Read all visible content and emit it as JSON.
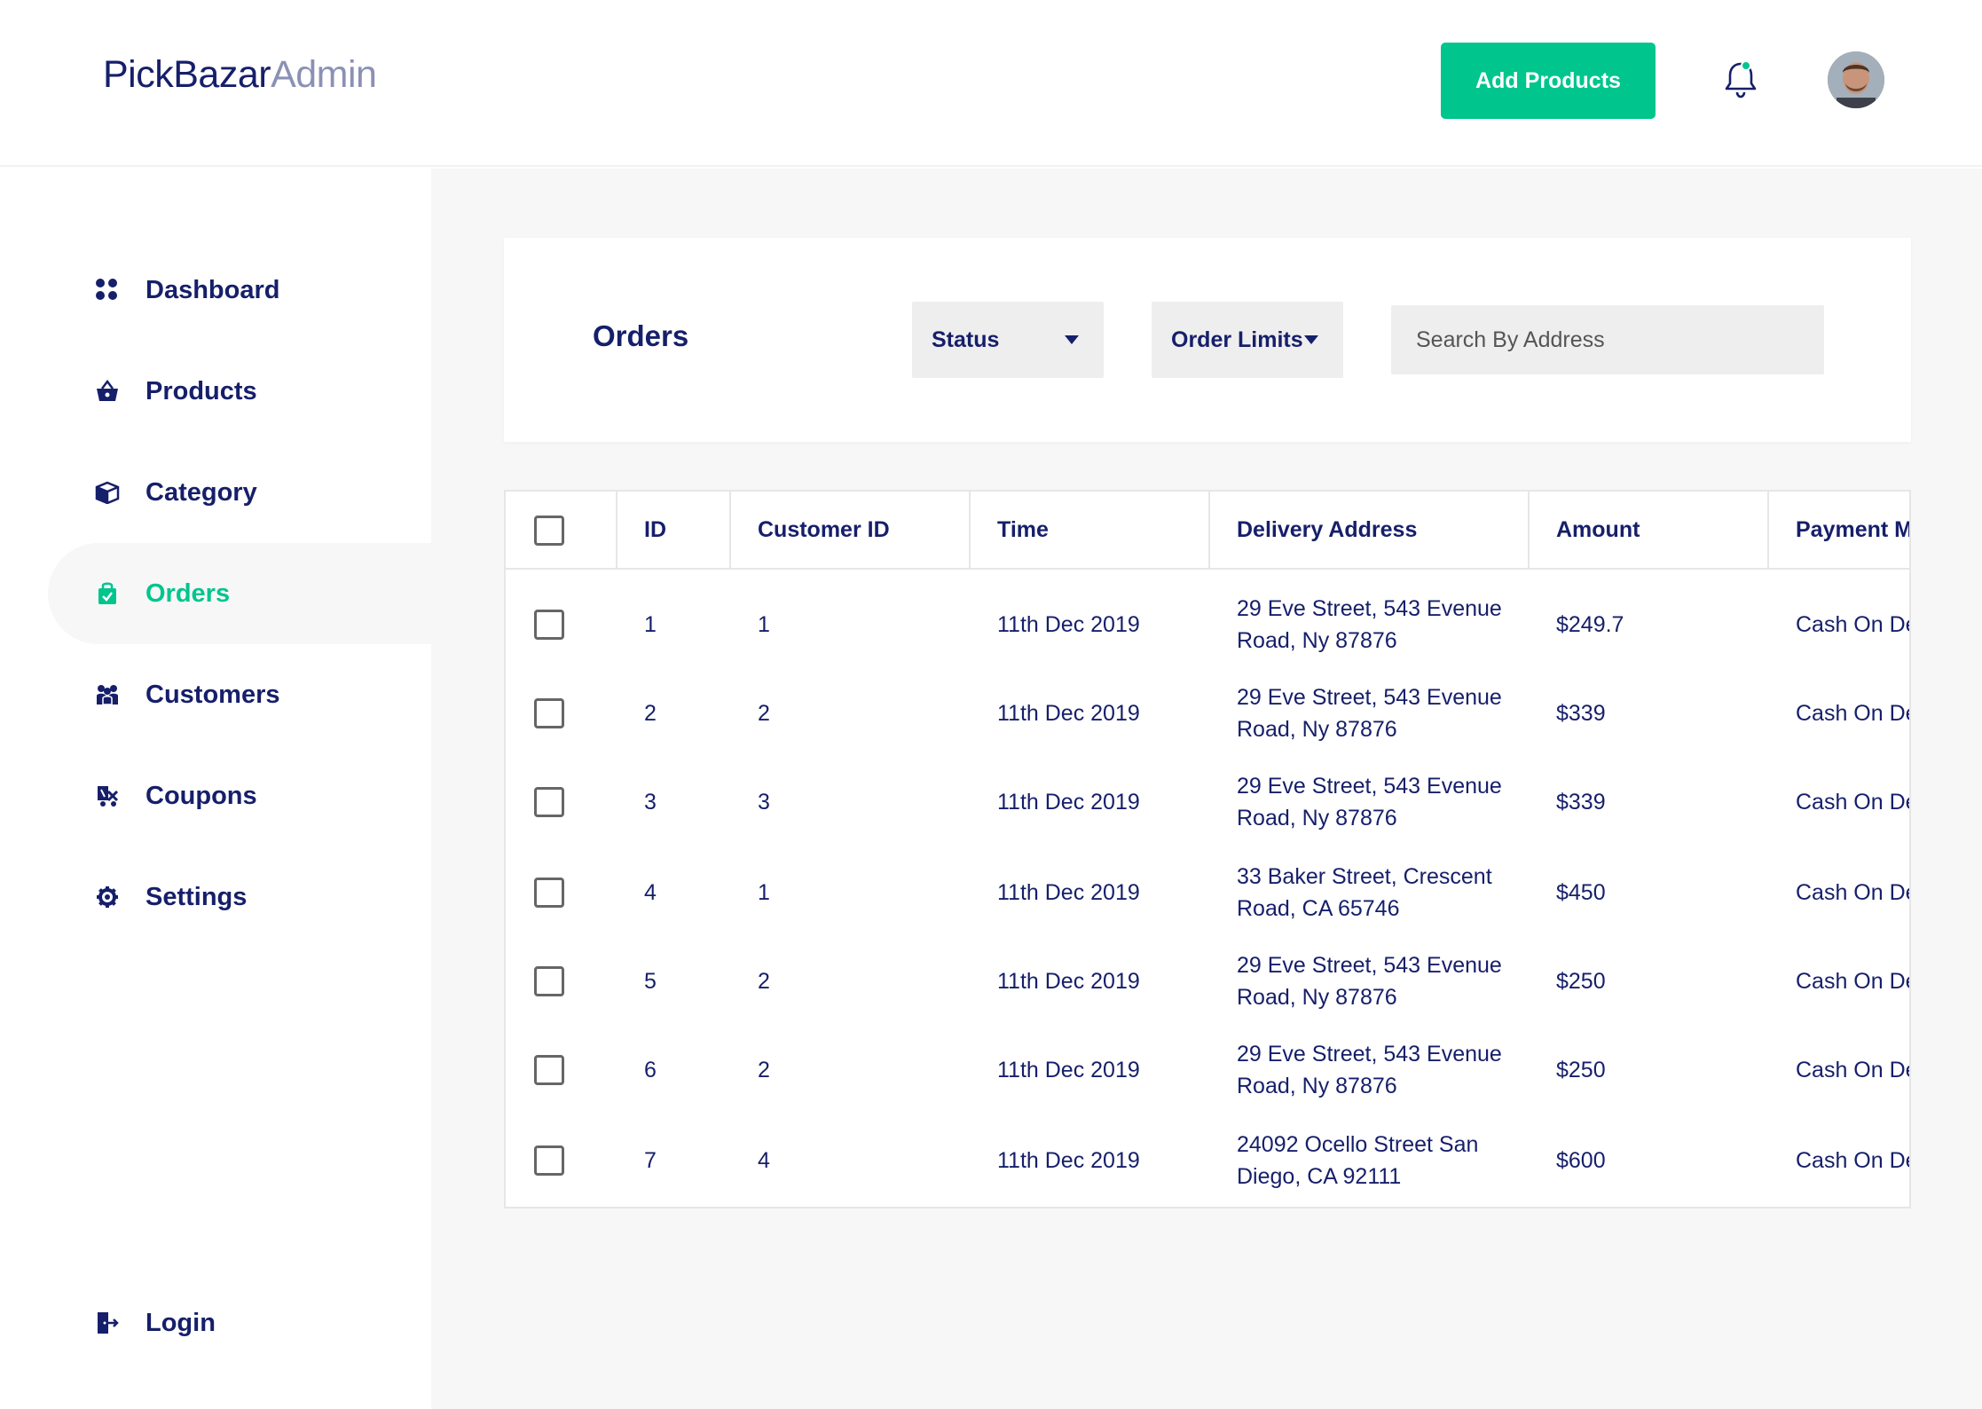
{
  "header": {
    "logo_brand": "PickBazar",
    "logo_suffix": "Admin",
    "add_button": "Add Products"
  },
  "sidebar": {
    "items": [
      {
        "label": "Dashboard",
        "icon": "dashboard-grid-icon"
      },
      {
        "label": "Products",
        "icon": "basket-icon"
      },
      {
        "label": "Category",
        "icon": "box-icon"
      },
      {
        "label": "Orders",
        "icon": "shopping-bag-icon",
        "active": true
      },
      {
        "label": "Customers",
        "icon": "users-icon"
      },
      {
        "label": "Coupons",
        "icon": "coupon-icon"
      },
      {
        "label": "Settings",
        "icon": "gear-icon"
      }
    ],
    "login": {
      "label": "Login",
      "icon": "logout-icon"
    }
  },
  "toolbar": {
    "title": "Orders",
    "status_select": "Status",
    "limits_select": "Order Limits",
    "search_placeholder": "Search By Address"
  },
  "table": {
    "columns": [
      "ID",
      "Customer ID",
      "Time",
      "Delivery Address",
      "Amount",
      "Payment Me"
    ],
    "rows": [
      {
        "id": "1",
        "customer_id": "1",
        "time": "11th Dec 2019",
        "address": "29 Eve Street, 543 Evenue Road, Ny 87876",
        "amount": "$249.7",
        "payment": "Cash On De"
      },
      {
        "id": "2",
        "customer_id": "2",
        "time": "11th Dec 2019",
        "address": "29 Eve Street, 543 Evenue Road, Ny 87876",
        "amount": "$339",
        "payment": "Cash On De"
      },
      {
        "id": "3",
        "customer_id": "3",
        "time": "11th Dec 2019",
        "address": "29 Eve Street, 543 Evenue Road, Ny 87876",
        "amount": "$339",
        "payment": "Cash On De"
      },
      {
        "id": "4",
        "customer_id": "1",
        "time": "11th Dec 2019",
        "address": "33 Baker Street, Crescent Road, CA 65746",
        "amount": "$450",
        "payment": "Cash On De"
      },
      {
        "id": "5",
        "customer_id": "2",
        "time": "11th Dec 2019",
        "address": "29 Eve Street, 543 Evenue Road, Ny 87876",
        "amount": "$250",
        "payment": "Cash On De"
      },
      {
        "id": "6",
        "customer_id": "2",
        "time": "11th Dec 2019",
        "address": "29 Eve Street, 543 Evenue Road, Ny 87876",
        "amount": "$250",
        "payment": "Cash On De"
      },
      {
        "id": "7",
        "customer_id": "4",
        "time": "11th Dec 2019",
        "address": "24092 Ocello Street San Diego, CA 92111",
        "amount": "$600",
        "payment": "Cash On De"
      }
    ]
  },
  "colors": {
    "primary": "#161f6a",
    "accent": "#00c58d",
    "muted": "#8a91b4",
    "background": "#f7f7f7"
  }
}
